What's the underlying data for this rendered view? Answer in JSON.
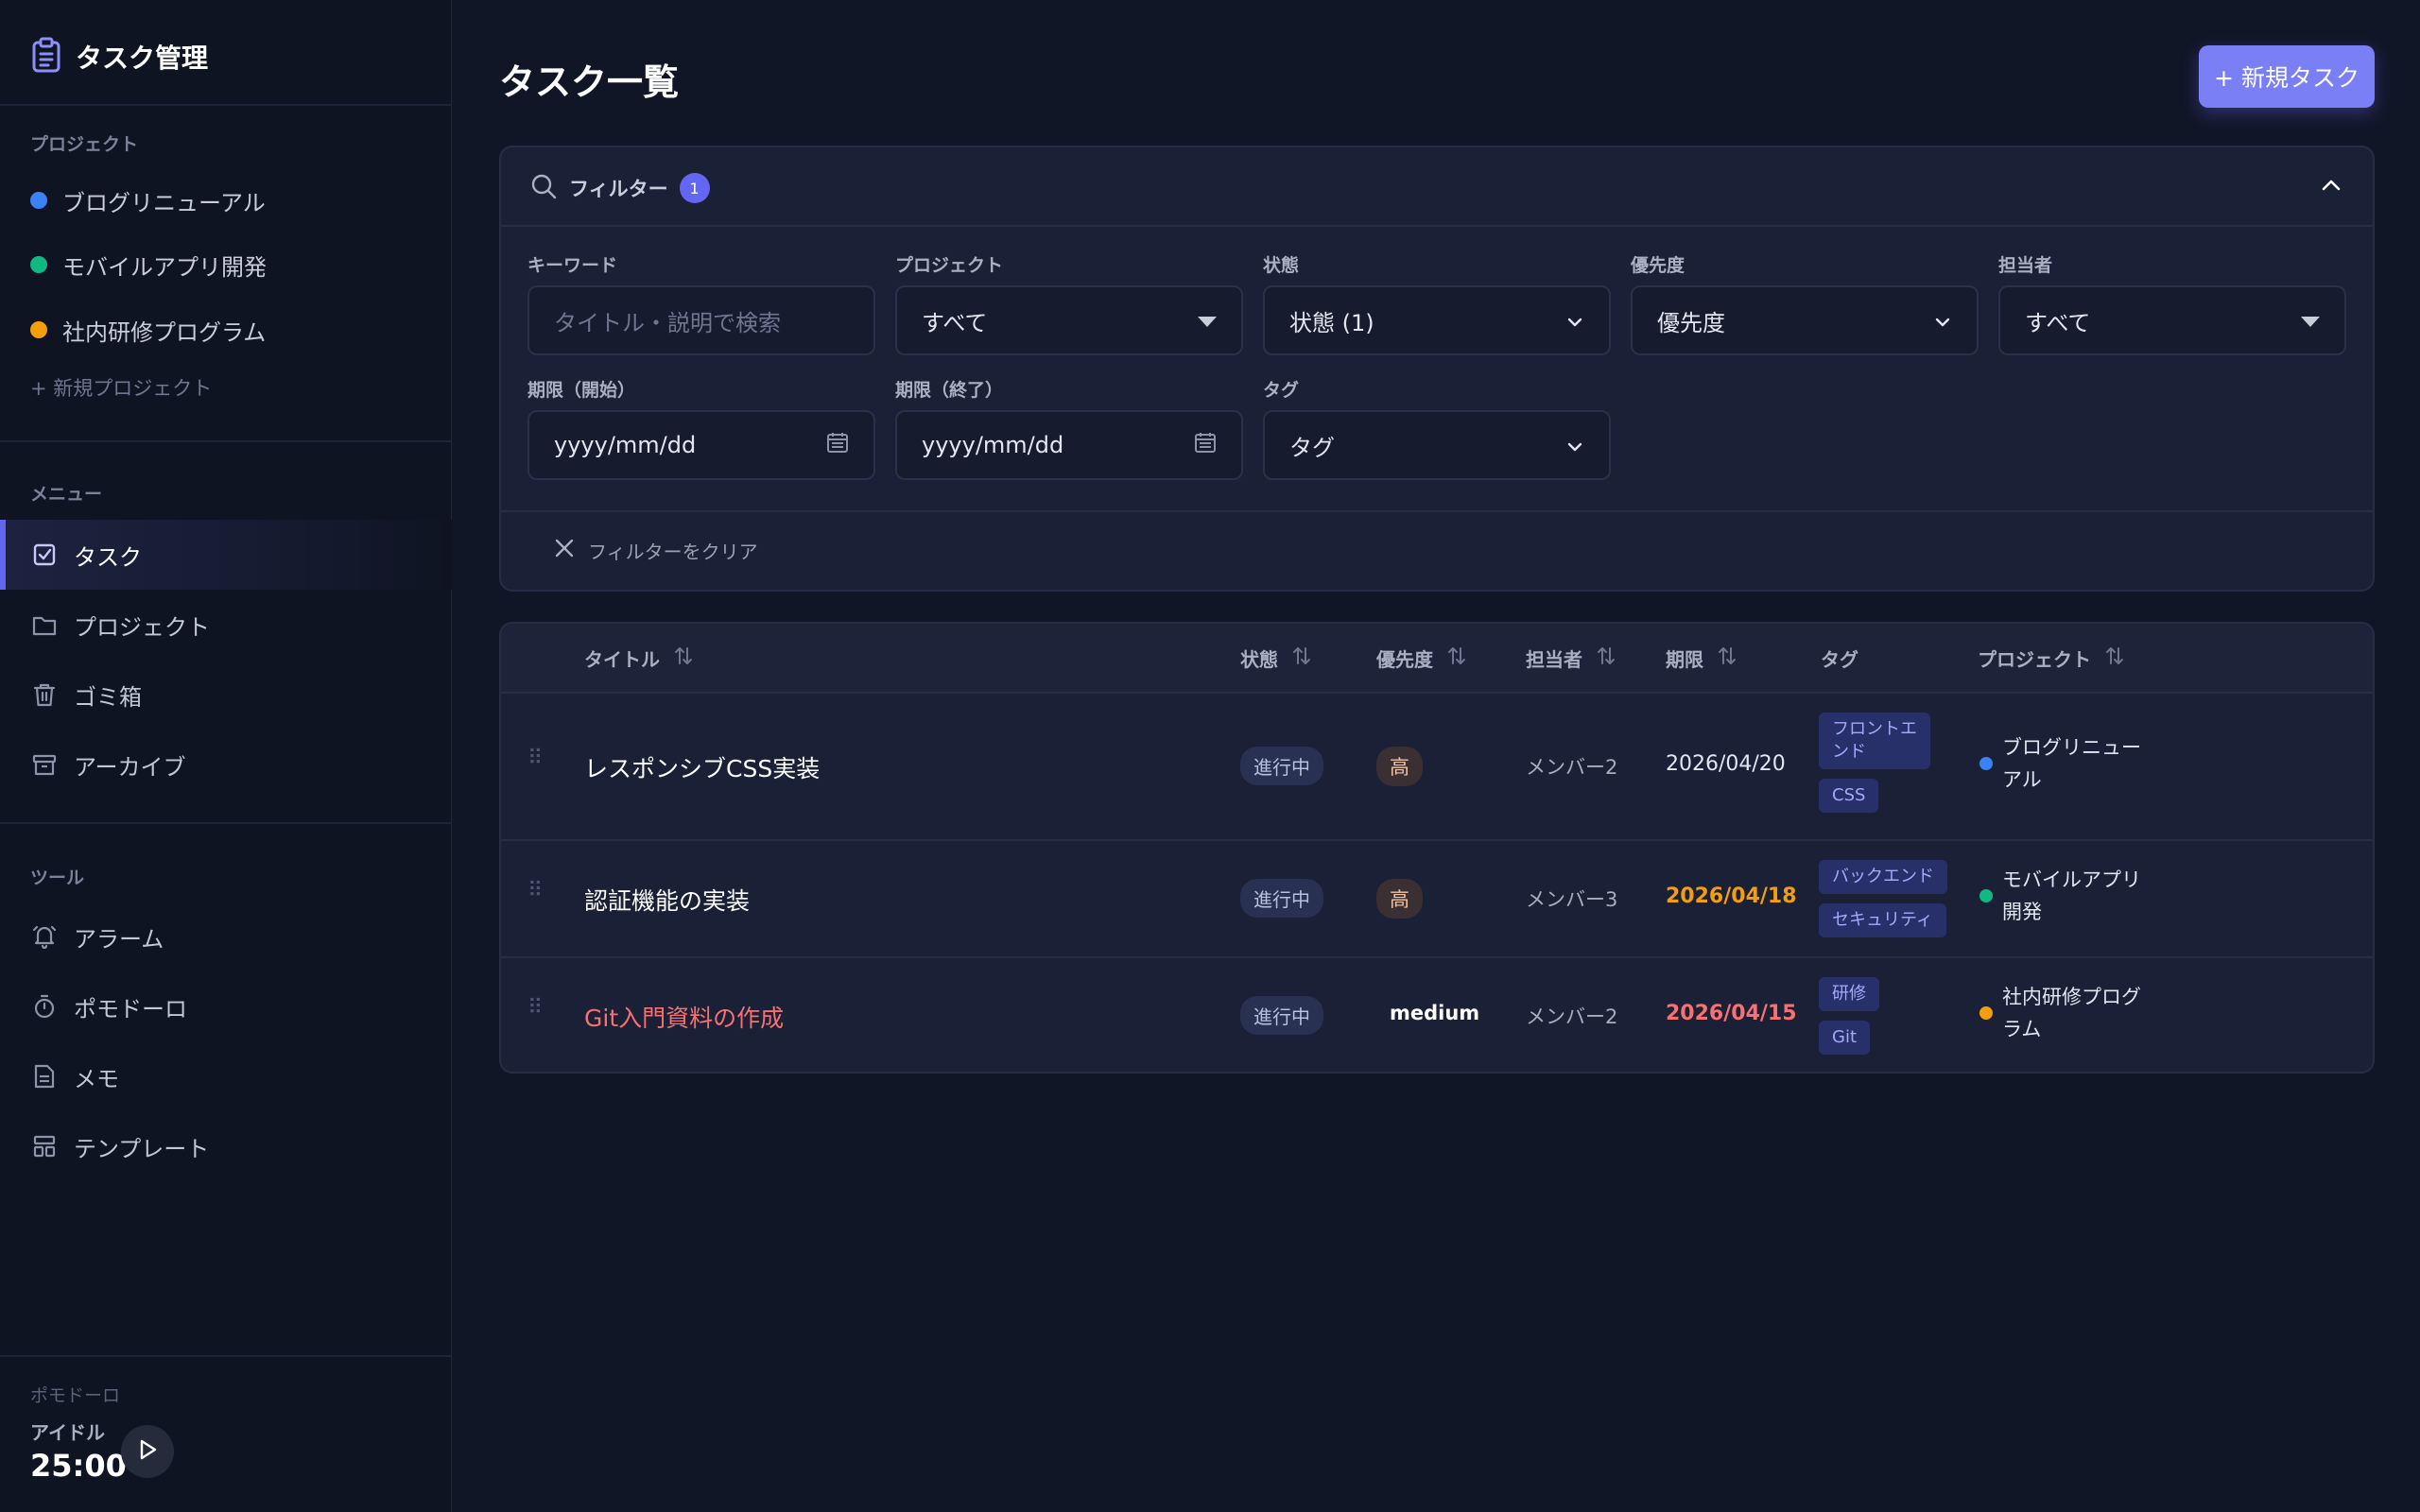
{
  "app": {
    "title": "タスク管理"
  },
  "colors": {
    "accent": "#6366f1",
    "blue": "#3b82f6",
    "green": "#10b981",
    "orange": "#f59e0b",
    "red": "#f87171"
  },
  "sidebar": {
    "projects_heading": "プロジェクト",
    "projects": [
      {
        "label": "ブログリニューアル",
        "color": "#3b82f6"
      },
      {
        "label": "モバイルアプリ開発",
        "color": "#10b981"
      },
      {
        "label": "社内研修プログラム",
        "color": "#f59e0b"
      }
    ],
    "new_project": "+ 新規プロジェクト",
    "menu_heading": "メニュー",
    "menu": [
      {
        "label": "タスク",
        "icon": "check-square-icon",
        "active": true
      },
      {
        "label": "プロジェクト",
        "icon": "folder-icon"
      },
      {
        "label": "ゴミ箱",
        "icon": "trash-icon"
      },
      {
        "label": "アーカイブ",
        "icon": "archive-icon"
      }
    ],
    "tools_heading": "ツール",
    "tools": [
      {
        "label": "アラーム",
        "icon": "bell-icon"
      },
      {
        "label": "ポモドーロ",
        "icon": "timer-icon"
      },
      {
        "label": "メモ",
        "icon": "note-icon"
      },
      {
        "label": "テンプレート",
        "icon": "template-icon"
      }
    ],
    "pomodoro": {
      "label": "ポモドーロ",
      "state": "アイドル",
      "time": "25:00"
    }
  },
  "main": {
    "title": "タスク一覧",
    "new_task_button": "+ 新規タスク",
    "filter": {
      "title": "フィルター",
      "badge": "1",
      "keyword": {
        "label": "キーワード",
        "placeholder": "タイトル・説明で検索"
      },
      "project": {
        "label": "プロジェクト",
        "value": "すべて"
      },
      "status": {
        "label": "状態",
        "value": "状態 (1)"
      },
      "priority": {
        "label": "優先度",
        "value": "優先度"
      },
      "assignee": {
        "label": "担当者",
        "value": "すべて"
      },
      "due_start": {
        "label": "期限（開始）",
        "value": "yyyy/mm/dd"
      },
      "due_end": {
        "label": "期限（終了）",
        "value": "yyyy/mm/dd"
      },
      "tag": {
        "label": "タグ",
        "value": "タグ"
      },
      "clear": "フィルターをクリア"
    },
    "table": {
      "headers": {
        "title": "タイトル",
        "status": "状態",
        "priority": "優先度",
        "assignee": "担当者",
        "due": "期限",
        "tags": "タグ",
        "project": "プロジェクト"
      },
      "rows": [
        {
          "title": "レスポンシブCSS実装",
          "status": "進行中",
          "priority": "高",
          "assignee": "メンバー2",
          "due": "2026/04/20",
          "tags": [
            "フロントエンド",
            "CSS"
          ],
          "project": "ブログリニューアル",
          "project_color": "#3b82f6"
        },
        {
          "title": "認証機能の実装",
          "status": "進行中",
          "priority": "高",
          "assignee": "メンバー3",
          "due": "2026/04/18",
          "tags": [
            "バックエンド",
            "セキュリティ"
          ],
          "project": "モバイルアプリ開発",
          "project_color": "#10b981"
        },
        {
          "title": "Git入門資料の作成",
          "status": "進行中",
          "priority": "medium",
          "assignee": "メンバー2",
          "due": "2026/04/15",
          "tags": [
            "研修",
            "Git"
          ],
          "project": "社内研修プログラム",
          "project_color": "#f59e0b"
        }
      ]
    }
  }
}
